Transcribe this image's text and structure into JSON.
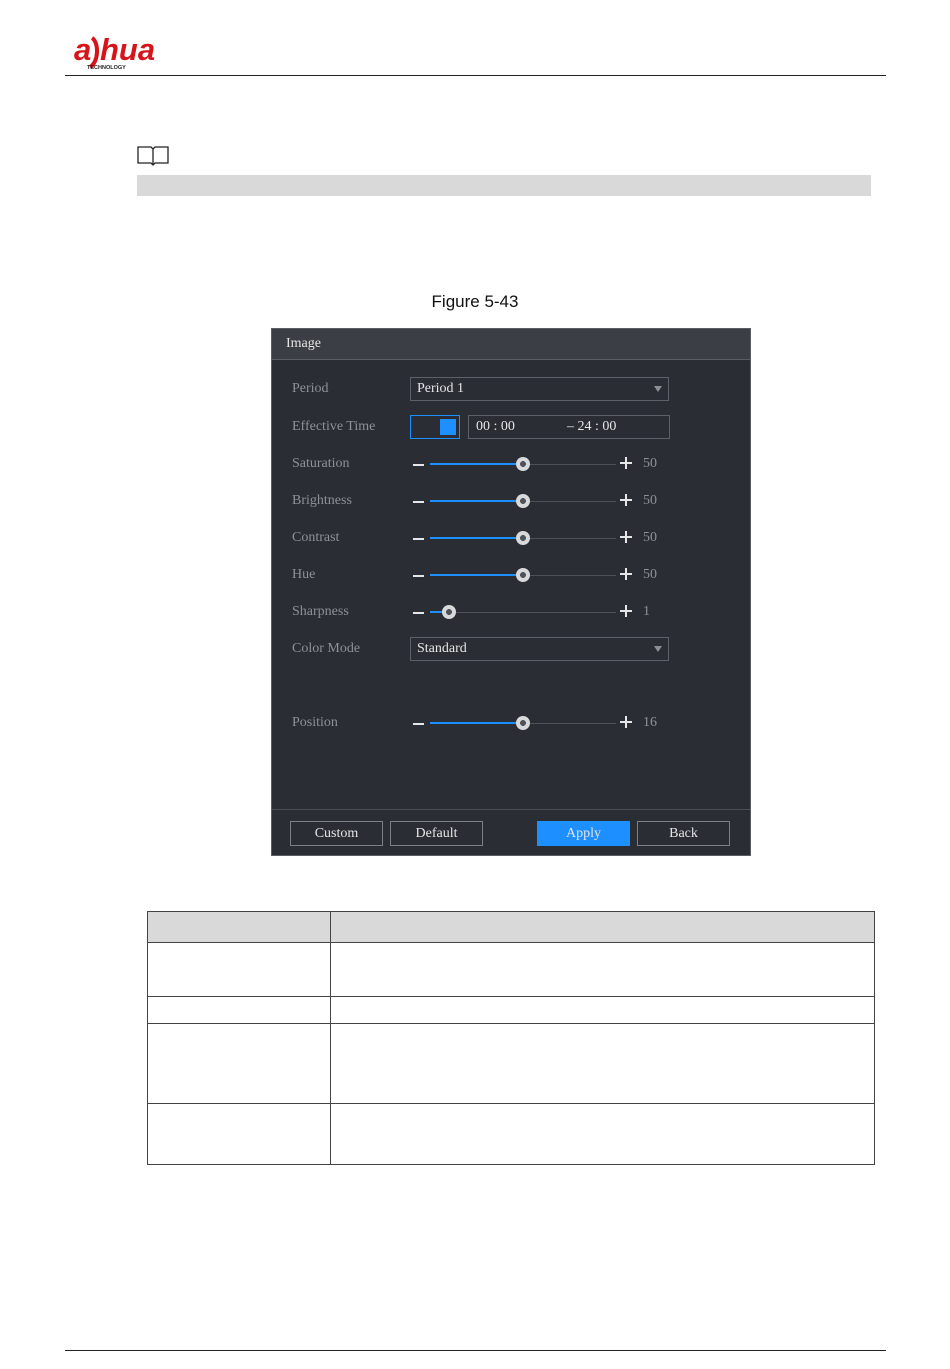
{
  "brand": {
    "logo_text": "alhua",
    "logo_sub": "TECHNOLOGY"
  },
  "caption": "Figure 5-43",
  "dialog": {
    "title": "Image",
    "period_label": "Period",
    "period_value": "Period 1",
    "effective_time_label": "Effective Time",
    "effective_time_enabled": true,
    "time_start": "00 : 00",
    "time_end": "– 24 : 00",
    "sliders": [
      {
        "label": "Saturation",
        "value": "50",
        "fraction": 0.5
      },
      {
        "label": "Brightness",
        "value": "50",
        "fraction": 0.5
      },
      {
        "label": "Contrast",
        "value": "50",
        "fraction": 0.5
      },
      {
        "label": "Hue",
        "value": "50",
        "fraction": 0.5
      },
      {
        "label": "Sharpness",
        "value": "1",
        "fraction": 0.1
      }
    ],
    "color_mode_label": "Color Mode",
    "color_mode_value": "Standard",
    "position": {
      "label": "Position",
      "value": "16",
      "fraction": 0.5
    },
    "buttons": {
      "custom": "Custom",
      "default": "Default",
      "apply": "Apply",
      "back": "Back"
    },
    "colors": {
      "accent": "#1d8fff",
      "background": "#2a2d34",
      "titlebar": "#3b3e45"
    }
  },
  "icons": {
    "note": "book-icon",
    "dropdown": "caret-down-icon"
  }
}
